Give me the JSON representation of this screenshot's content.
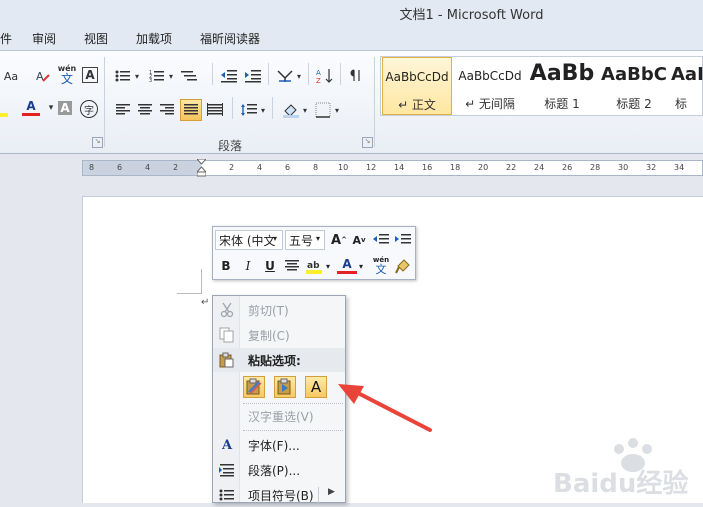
{
  "window": {
    "title": "文档1 - Microsoft Word"
  },
  "tabs": [
    "件",
    "审阅",
    "视图",
    "加载项",
    "福昕阅读器"
  ],
  "ribbon": {
    "font_group_glyphs": {
      "aa": "Aa",
      "wen": "wén",
      "wen2": "文",
      "a_box": "A",
      "a_color": "A",
      "a_shade": "A",
      "circle": "字"
    },
    "paragraph_group_label": "段落",
    "styles": [
      {
        "preview": "AaBbCcDd",
        "name": "↵ 正文"
      },
      {
        "preview": "AaBbCcDd",
        "name": "↵ 无间隔"
      },
      {
        "preview": "AaBb",
        "name": "标题 1"
      },
      {
        "preview": "AaBbC",
        "name": "标题 2"
      },
      {
        "preview": "AaI",
        "name": "标"
      }
    ]
  },
  "ruler": {
    "ticks": [
      "8",
      "6",
      "4",
      "2",
      "2",
      "4",
      "6",
      "8",
      "10",
      "12",
      "14",
      "16",
      "18",
      "20",
      "22",
      "24",
      "26",
      "28",
      "30",
      "32",
      "34"
    ]
  },
  "mini_toolbar": {
    "font": "宋体 (中文",
    "size": "五号",
    "grow": "A",
    "shrink": "A",
    "bold": "B",
    "italic": "I",
    "underline": "U",
    "font_color": "A",
    "phonetic": "wén"
  },
  "context_menu": {
    "cut": "剪切(T)",
    "copy": "复制(C)",
    "paste_options": "粘贴选项:",
    "paste_text_only": "A",
    "reconvert": "汉字重选(V)",
    "font": "字体(F)...",
    "paragraph": "段落(P)...",
    "bullets": "项目符号(B)"
  },
  "watermark": "Baidu经验",
  "colors": {
    "accent_arrow": "#e8443a",
    "selected_style": "#f7c35a",
    "menu_bg": "#f5f6f8"
  }
}
